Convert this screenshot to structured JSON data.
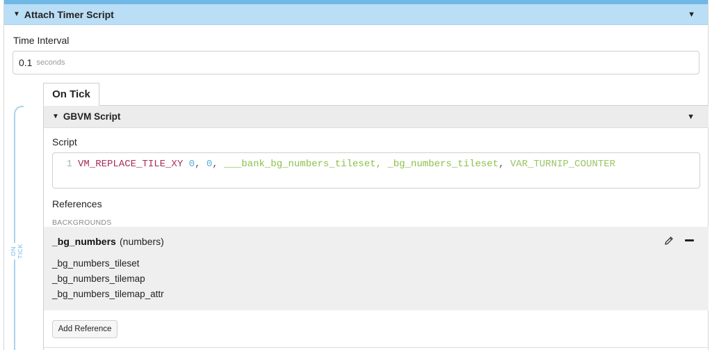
{
  "event": {
    "title": "Attach Timer Script",
    "time_interval_label": "Time Interval",
    "time_interval_value": "0.1",
    "time_interval_unit": "seconds"
  },
  "tab": {
    "label": "On Tick",
    "side_label": "ON TICK"
  },
  "gbvm": {
    "title": "GBVM Script",
    "script_label": "Script",
    "code_line_number": "1",
    "code_tokens": [
      {
        "text": "VM_REPLACE_TILE_XY",
        "kind": "keyword"
      },
      {
        "text": " ",
        "kind": "plain"
      },
      {
        "text": "0",
        "kind": "number"
      },
      {
        "text": ", ",
        "kind": "plain"
      },
      {
        "text": "0",
        "kind": "number"
      },
      {
        "text": ", ",
        "kind": "plain"
      },
      {
        "text": "___bank_bg_numbers_tileset, _bg_numbers_tileset",
        "kind": "symbol"
      },
      {
        "text": ", ",
        "kind": "plain"
      },
      {
        "text": "VAR_TURNIP_COUNTER",
        "kind": "variable"
      }
    ],
    "references_label": "References",
    "backgrounds_label": "BACKGROUNDS",
    "reference": {
      "name": "_bg_numbers",
      "type": "(numbers)",
      "symbols": [
        "_bg_numbers_tileset",
        "_bg_numbers_tilemap",
        "_bg_numbers_tilemap_attr"
      ]
    },
    "add_reference_label": "Add Reference"
  },
  "icons": {
    "collapse": "triangle-down-icon",
    "menu": "caret-down-icon",
    "edit": "pencil-icon",
    "remove": "minus-icon"
  },
  "colors": {
    "event_header_bg": "#b9def6",
    "top_strip": "#6fb8e6",
    "keyword": "#a62d5b",
    "number": "#5aaed8",
    "symbol": "#8cc04b",
    "variable": "#96c664"
  }
}
